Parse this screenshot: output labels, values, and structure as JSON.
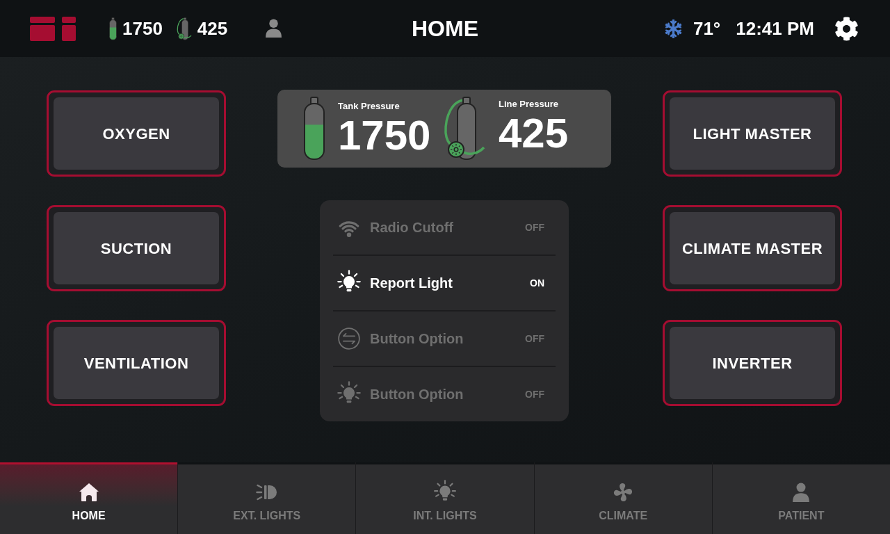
{
  "header": {
    "tank_reading": "1750",
    "line_reading": "425",
    "title": "HOME",
    "temperature": "71°",
    "time": "12:41 PM"
  },
  "left_buttons": [
    {
      "label": "OXYGEN"
    },
    {
      "label": "SUCTION"
    },
    {
      "label": "VENTILATION"
    }
  ],
  "pressure_card": {
    "tank": {
      "label": "Tank Pressure",
      "value": "1750",
      "level": 0.62
    },
    "line": {
      "label": "Line Pressure",
      "value": "425"
    }
  },
  "toggles": [
    {
      "kind": "wifi",
      "label": "Radio Cutoff",
      "state": "OFF",
      "on": false
    },
    {
      "kind": "bulb",
      "label": "Report Light",
      "state": "ON",
      "on": true
    },
    {
      "kind": "swap",
      "label": "Button Option",
      "state": "OFF",
      "on": false
    },
    {
      "kind": "bulb",
      "label": "Button Option",
      "state": "OFF",
      "on": false
    }
  ],
  "right_buttons": [
    {
      "label": "LIGHT MASTER"
    },
    {
      "label": "CLIMATE MASTER"
    },
    {
      "label": "INVERTER"
    }
  ],
  "nav": [
    {
      "kind": "home",
      "label": "HOME",
      "selected": true
    },
    {
      "kind": "ext_lights",
      "label": "EXT. LIGHTS",
      "selected": false
    },
    {
      "kind": "int_lights",
      "label": "INT. LIGHTS",
      "selected": false
    },
    {
      "kind": "climate",
      "label": "CLIMATE",
      "selected": false
    },
    {
      "kind": "patient",
      "label": "PATIENT",
      "selected": false
    }
  ]
}
